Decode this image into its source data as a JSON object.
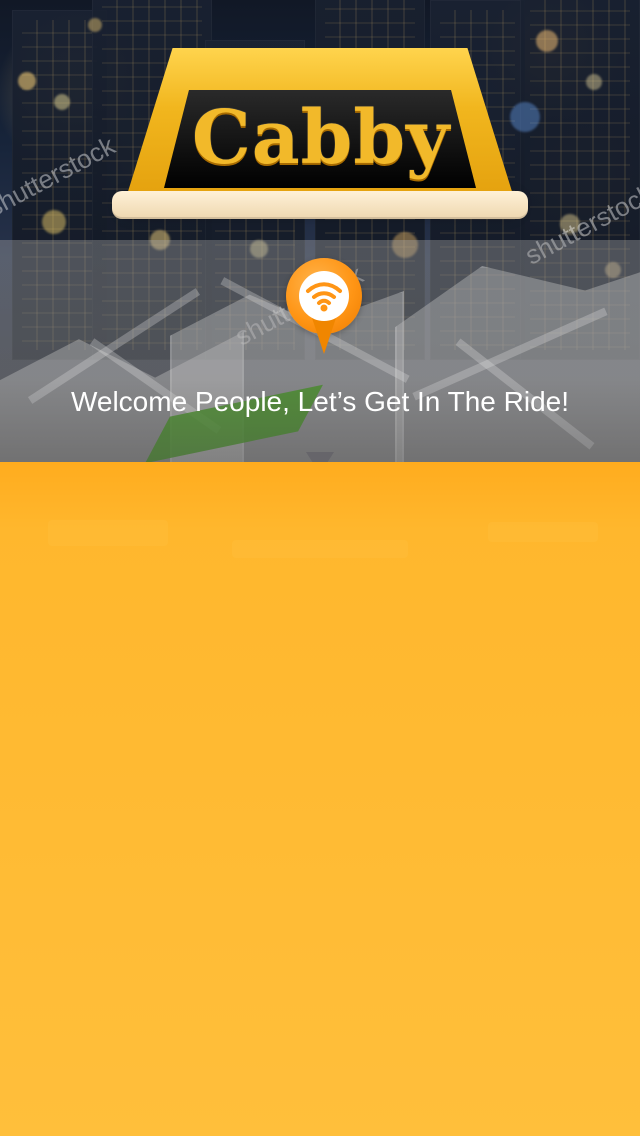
{
  "hero": {
    "logo_text": "Cabby",
    "welcome_text": "Welcome People, Let’s Get In The Ride!",
    "watermark_text": "shutterstock"
  },
  "pin": {
    "icon": "wifi-icon"
  },
  "colors": {
    "background_orange": "#ffbf3b",
    "logo_yellow": "#f2b92a",
    "pin_orange": "#ff9515",
    "welcome_white": "#ffffff"
  }
}
